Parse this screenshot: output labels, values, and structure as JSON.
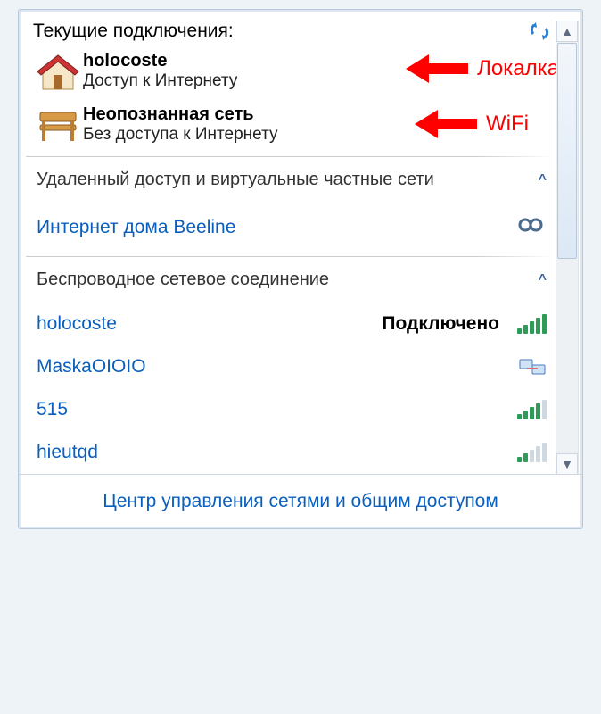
{
  "header": {
    "title": "Текущие подключения:"
  },
  "icons": {
    "refresh": "refresh-icon",
    "expand": "^"
  },
  "connections": [
    {
      "name": "holocoste",
      "status": "Доступ к Интернету",
      "icon": "house-icon",
      "annot_label": "Локалка"
    },
    {
      "name": "Неопознанная сеть",
      "status": "Без доступа к Интернету",
      "icon": "bench-icon",
      "annot_label": "WiFi"
    }
  ],
  "sections": {
    "vpn": {
      "title": "Удаленный доступ и виртуальные частные сети",
      "items": [
        {
          "label": "Интернет дома Beeline",
          "icon": "vpn-icon"
        }
      ]
    },
    "wifi": {
      "title": "Беспроводное сетевое соединение",
      "items": [
        {
          "name": "holocoste",
          "status": "Подключено",
          "bars": 5
        },
        {
          "name": "MaskaOIOIO",
          "status": "",
          "bars": 0
        },
        {
          "name": "515",
          "status": "",
          "bars": 4
        },
        {
          "name": "hieutqd",
          "status": "",
          "bars": 2
        }
      ]
    }
  },
  "footer": {
    "link": "Центр управления сетями и общим доступом"
  }
}
